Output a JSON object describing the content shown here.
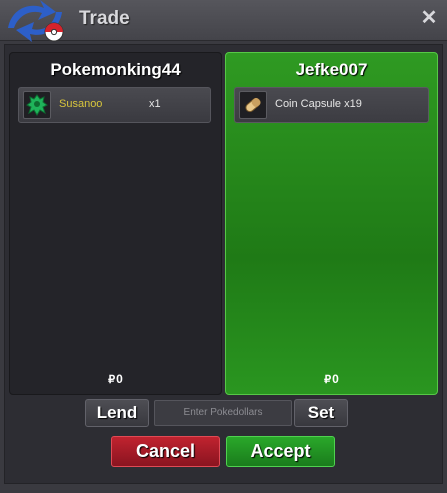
{
  "window": {
    "title": "Trade"
  },
  "left_panel": {
    "player": "Pokemonking44",
    "item": {
      "name": "Susanoo",
      "qty": "x1",
      "icon": "susanoo-icon",
      "icon_color": "#1fb35a"
    },
    "money": "0"
  },
  "right_panel": {
    "player": "Jefke007",
    "item": {
      "name": "Coin Capsule",
      "qty": "x19",
      "icon": "coin-capsule-icon",
      "icon_color": "#d9b36a"
    },
    "money": "0",
    "accent": "#2a9620"
  },
  "controls": {
    "lend_label": "Lend",
    "money_placeholder": "Enter Pokedollars",
    "set_label": "Set",
    "cancel_label": "Cancel",
    "accept_label": "Accept"
  },
  "colors": {
    "cancel": "#a81c28",
    "accept": "#22922a",
    "susanoo_text": "#d7c53c"
  }
}
